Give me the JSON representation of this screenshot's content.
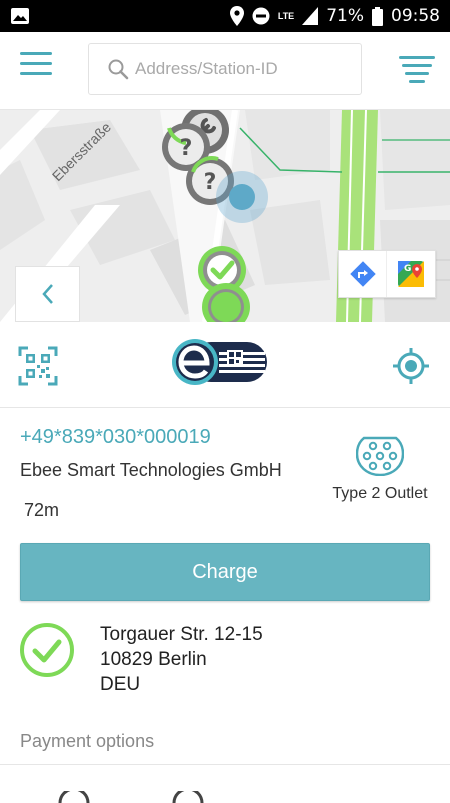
{
  "status_bar": {
    "battery": "71%",
    "time": "09:58",
    "network": "LTE"
  },
  "header": {
    "search_placeholder": "Address/Station-ID"
  },
  "map": {
    "street_name": "Ebersstraße"
  },
  "station": {
    "id": "+49*839*030*000019",
    "operator": "Ebee Smart Technologies GmbH",
    "distance": "72m",
    "connector": "Type 2 Outlet",
    "status": "available",
    "address": {
      "street": "Torgauer Str. 12-15",
      "city": "10829 Berlin",
      "country": "DEU"
    }
  },
  "actions": {
    "charge_label": "Charge"
  },
  "payment": {
    "title": "Payment options"
  },
  "colors": {
    "accent": "#4aa9b8",
    "button": "#67b5c1",
    "available": "#7ed957"
  }
}
